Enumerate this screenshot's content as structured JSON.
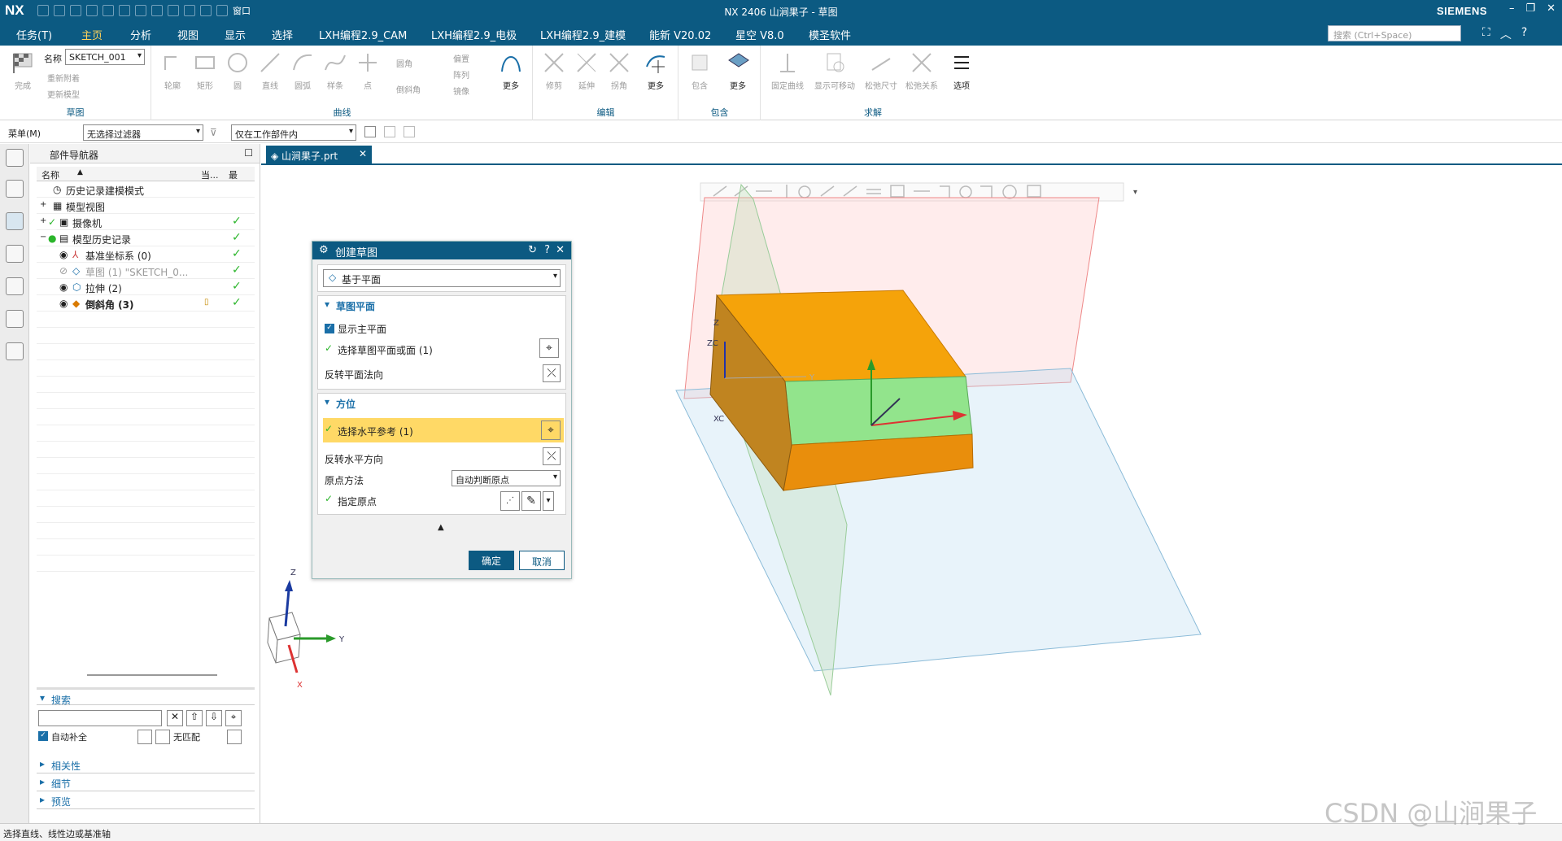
{
  "app": {
    "logo": "NX",
    "title": "NX 2406 山涧果子 - 草图",
    "brand": "SIEMENS",
    "window_menu": "窗口"
  },
  "menu": {
    "tabs": [
      "任务(T)",
      "主页",
      "分析",
      "视图",
      "显示",
      "选择",
      "LXH编程2.9_CAM",
      "LXH编程2.9_电极",
      "LXH编程2.9_建模",
      "能新 V20.02",
      "星空 V8.0",
      "模圣软件"
    ],
    "active": "主页",
    "search_placeholder": "搜索 (Ctrl+Space)"
  },
  "ribbon": {
    "sketch": {
      "name_label": "名称",
      "name_value": "SKETCH_001",
      "finish": "完成",
      "update_ref": "重新附着",
      "update_model": "更新模型",
      "group": "草图"
    },
    "curve": {
      "items": [
        "轮廓",
        "矩形",
        "圆",
        "直线",
        "圆弧",
        "样条",
        "点"
      ],
      "side": [
        "圆角",
        "倒斜角"
      ],
      "more": "更多",
      "extra": [
        "偏置",
        "阵列",
        "镜像"
      ],
      "group": "曲线"
    },
    "edit": {
      "items": [
        "修剪",
        "延伸",
        "拐角"
      ],
      "more": "更多",
      "group": "编辑"
    },
    "include": {
      "items": [
        "包含"
      ],
      "more": "更多",
      "group": "包含"
    },
    "solve": {
      "items": [
        "固定曲线",
        "显示可移动",
        "松弛尺寸",
        "松弛关系"
      ],
      "options": "选项",
      "group": "求解"
    }
  },
  "filterbar": {
    "menu": "菜单(M)",
    "filter": "无选择过滤器",
    "scope": "仅在工作部件内"
  },
  "navigator": {
    "title": "部件导航器",
    "columns": [
      "名称",
      "当...",
      "最"
    ],
    "rows": [
      {
        "label": "历史记录建模模式",
        "check": ""
      },
      {
        "label": "模型视图",
        "check": ""
      },
      {
        "label": "摄像机",
        "check": "✓"
      },
      {
        "label": "模型历史记录",
        "check": "✓"
      },
      {
        "label": "基准坐标系 (0)",
        "check": "✓"
      },
      {
        "label": "草图 (1) \"SKETCH_0...",
        "check": "✓"
      },
      {
        "label": "拉伸 (2)",
        "check": "✓"
      },
      {
        "label": "倒斜角 (3)",
        "check": "✓"
      }
    ],
    "search": {
      "title": "搜索",
      "autocomplete": "自动补全",
      "nomatch": "无匹配"
    },
    "sections": [
      "相关性",
      "细节",
      "预览"
    ]
  },
  "document": {
    "tab": "山涧果子.prt"
  },
  "dialog": {
    "title": "创建草图",
    "type": "基于平面",
    "sec1": "草图平面",
    "show_plane": "显示主平面",
    "select_plane": "选择草图平面或面 (1)",
    "reverse_normal": "反转平面法向",
    "sec2": "方位",
    "select_horizontal": "选择水平参考 (1)",
    "reverse_horizontal": "反转水平方向",
    "origin_method_label": "原点方法",
    "origin_method_value": "自动判断原点",
    "specify_origin": "指定原点",
    "ok": "确定",
    "cancel": "取消"
  },
  "viewport": {
    "axis_z": "Z",
    "axis_y": "Y",
    "axis_x": "X",
    "zc": "ZC",
    "xc": "XC"
  },
  "status": "选择直线、线性边或基准轴",
  "watermark": "CSDN @山涧果子",
  "colors": {
    "brand": "#0c5a82",
    "box_top": "#ffa500",
    "box_face": "#90ee90",
    "check": "#2bb52b",
    "highlight": "#ffd966"
  }
}
